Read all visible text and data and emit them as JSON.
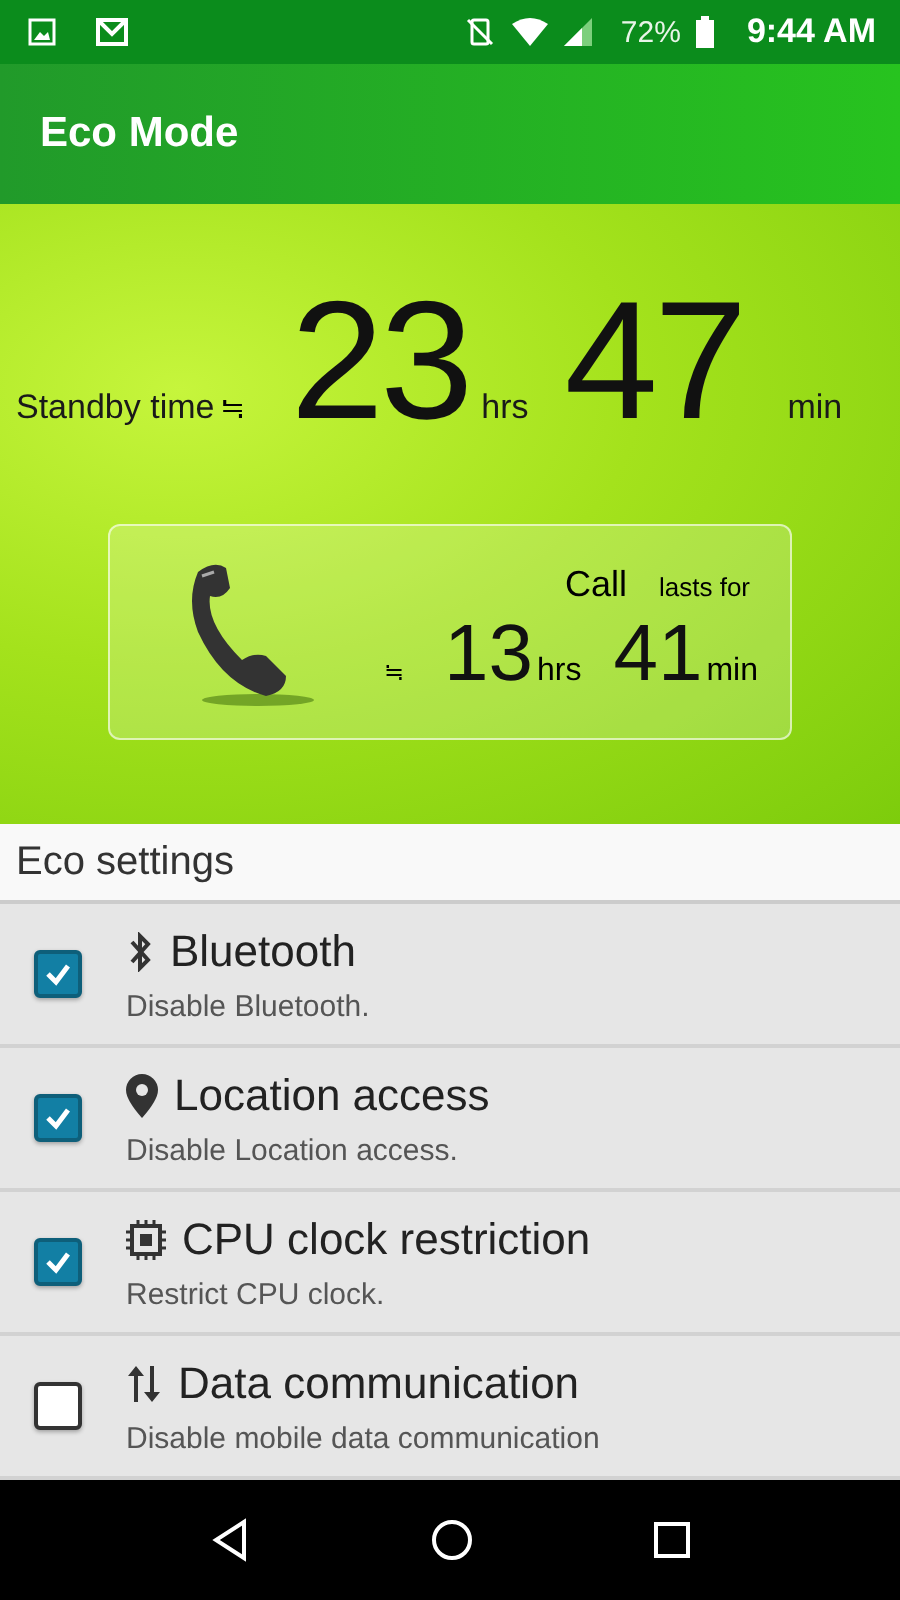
{
  "status_bar": {
    "battery": "72%",
    "time": "9:44 AM"
  },
  "app_bar": {
    "title": "Eco Mode"
  },
  "standby": {
    "label": "Standby time",
    "approx": "≒",
    "hours": "23",
    "hours_unit": "hrs",
    "minutes": "47",
    "minutes_unit": "min"
  },
  "call_card": {
    "label": "Call",
    "sublabel": "lasts for",
    "approx": "≒",
    "hours": "13",
    "hours_unit": "hrs",
    "minutes": "41",
    "minutes_unit": "min"
  },
  "section": {
    "title": "Eco settings"
  },
  "settings": [
    {
      "title": "Bluetooth",
      "description": "Disable Bluetooth.",
      "checked": true
    },
    {
      "title": "Location access",
      "description": "Disable Location access.",
      "checked": true
    },
    {
      "title": "CPU clock restriction",
      "description": "Restrict CPU clock.",
      "checked": true
    },
    {
      "title": "Data communication",
      "description": "Disable mobile data communication",
      "checked": false
    }
  ]
}
